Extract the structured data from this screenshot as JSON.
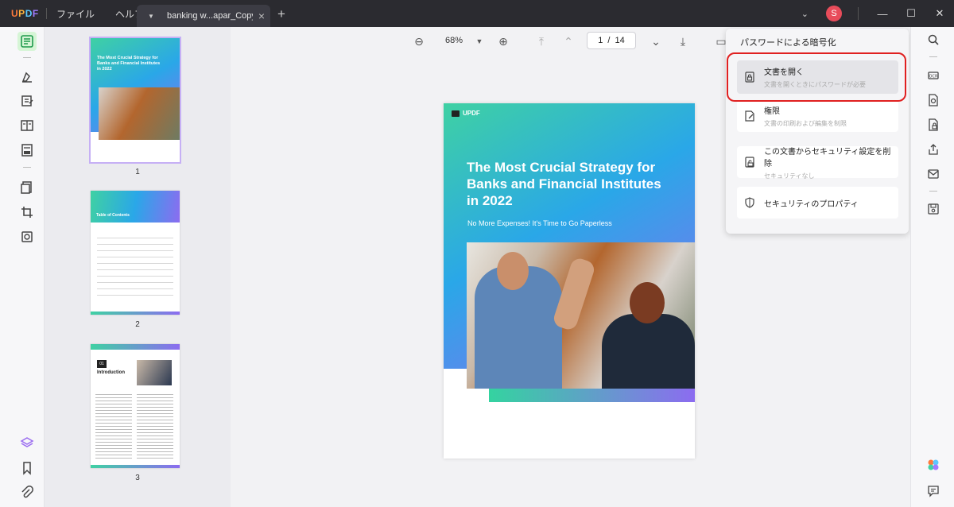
{
  "app": {
    "logo": "UPDF",
    "menu": [
      "ファイル",
      "ヘルプ"
    ],
    "tab_title": "banking w...apar_Copy",
    "avatar_initial": "S"
  },
  "viewer": {
    "zoom": "68%",
    "current_page": "1",
    "page_separator": "/",
    "total_pages": "14"
  },
  "thumbnails": [
    {
      "number": "1",
      "title": "The Most Crucial Strategy for Banks and Financial Institutes in 2022"
    },
    {
      "number": "2",
      "title": "Table of Contents"
    },
    {
      "number": "3",
      "title": "Introduction",
      "chapter": "01"
    }
  ],
  "document": {
    "logo": "UPDF",
    "title": "The Most Crucial Strategy for Banks and Financial Institutes in 2022",
    "subtitle": "No More Expenses! It's Time to Go Paperless"
  },
  "encrypt_panel": {
    "title": "パスワードによる暗号化",
    "options": [
      {
        "title": "文書を開く",
        "desc": "文書を開くときにパスワードが必要",
        "icon": "lock-doc-icon",
        "selected": true
      },
      {
        "title": "権限",
        "desc": "文書の印刷および編集を制限",
        "icon": "permission-edit-icon"
      },
      {
        "title": "この文書からセキュリティ設定を削除",
        "desc": "セキュリティなし",
        "icon": "unlock-doc-icon"
      },
      {
        "title": "セキュリティのプロパティ",
        "desc": "",
        "icon": "shield-icon"
      }
    ]
  },
  "colors": {
    "highlight": "#e02020",
    "accent_green": "#3fd1a3",
    "accent_purple": "#8c6cf0"
  }
}
